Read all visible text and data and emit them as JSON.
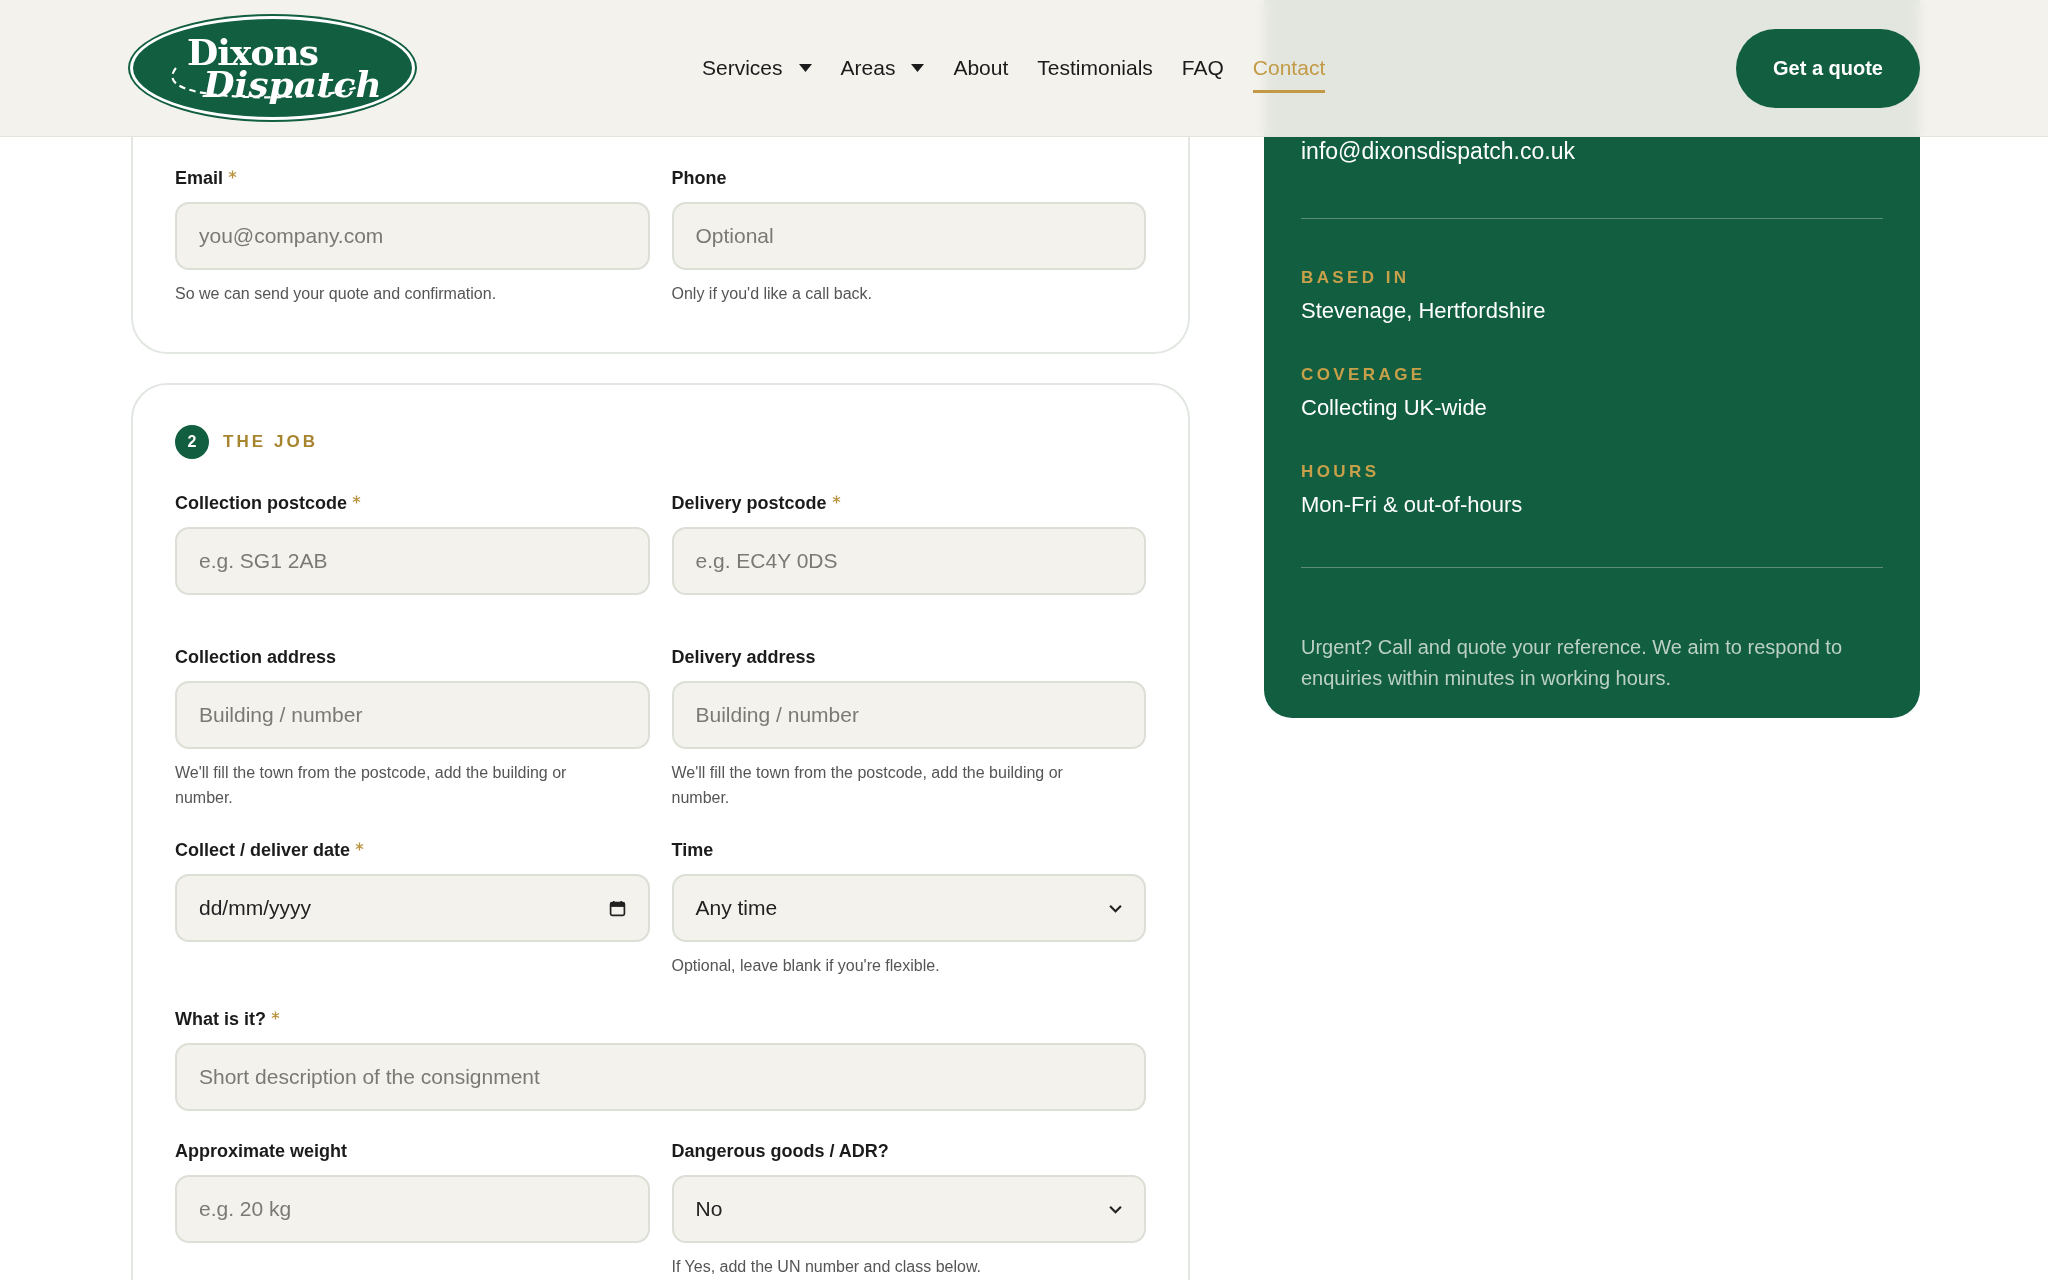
{
  "header": {
    "logo": {
      "line_1": "Dixons",
      "line_2": "Dispatch"
    },
    "nav": [
      {
        "label": "Services",
        "dropdown": true,
        "selected": false
      },
      {
        "label": "Areas",
        "dropdown": true,
        "selected": false
      },
      {
        "label": "About",
        "dropdown": false,
        "selected": false
      },
      {
        "label": "Testimonials",
        "dropdown": false,
        "selected": false
      },
      {
        "label": "FAQ",
        "dropdown": false,
        "selected": false
      },
      {
        "label": "Contact",
        "dropdown": false,
        "selected": true
      }
    ],
    "cta": "Get a quote"
  },
  "form": {
    "sections": [
      {
        "rows": [
          [
            {
              "label": "Email",
              "required": true,
              "kind": "text",
              "placeholder": "you@company.com",
              "hint": "So we can send your quote and confirmation."
            },
            {
              "label": "Phone",
              "required": false,
              "kind": "text",
              "placeholder": "Optional",
              "hint": "Only if you'd like a call back."
            }
          ]
        ]
      },
      {
        "step": "2",
        "title": "THE JOB",
        "rows": [
          [
            {
              "label": "Collection postcode",
              "required": true,
              "kind": "text",
              "placeholder": "e.g. SG1 2AB"
            },
            {
              "label": "Delivery postcode",
              "required": true,
              "kind": "text",
              "placeholder": "e.g. EC4Y 0DS"
            }
          ],
          [
            {
              "label": "Collection address",
              "required": false,
              "kind": "text",
              "placeholder": "Building / number",
              "hint": "We'll fill the town from the postcode, add the building or number."
            },
            {
              "label": "Delivery address",
              "required": false,
              "kind": "text",
              "placeholder": "Building / number",
              "hint": "We'll fill the town from the postcode, add the building or number."
            }
          ],
          [
            {
              "label": "Collect / deliver date",
              "required": true,
              "kind": "date",
              "value": "dd/mm/yyyy"
            },
            {
              "label": "Time",
              "required": false,
              "kind": "select",
              "value": "Any time",
              "hint": "Optional, leave blank if you're flexible."
            }
          ],
          [
            {
              "label": "What is it?",
              "required": true,
              "kind": "text",
              "placeholder": "Short description of the consignment"
            }
          ],
          [
            {
              "label": "Approximate weight",
              "required": false,
              "kind": "text",
              "placeholder": "e.g. 20 kg"
            },
            {
              "label": "Dangerous goods / ADR?",
              "required": false,
              "kind": "select",
              "value": "No",
              "hint": "If Yes, add the UN number and class below."
            }
          ]
        ]
      }
    ]
  },
  "contact_panel": {
    "email": "info@dixonsdispatch.co.uk",
    "details": [
      {
        "label": "BASED IN",
        "value": "Stevenage, Hertfordshire"
      },
      {
        "label": "COVERAGE",
        "value": "Collecting UK-wide"
      },
      {
        "label": "HOURS",
        "value": "Mon-Fri & out-of-hours"
      }
    ],
    "note": "Urgent? Call and quote your reference. We aim to respond to enquiries within minutes in working hours."
  }
}
